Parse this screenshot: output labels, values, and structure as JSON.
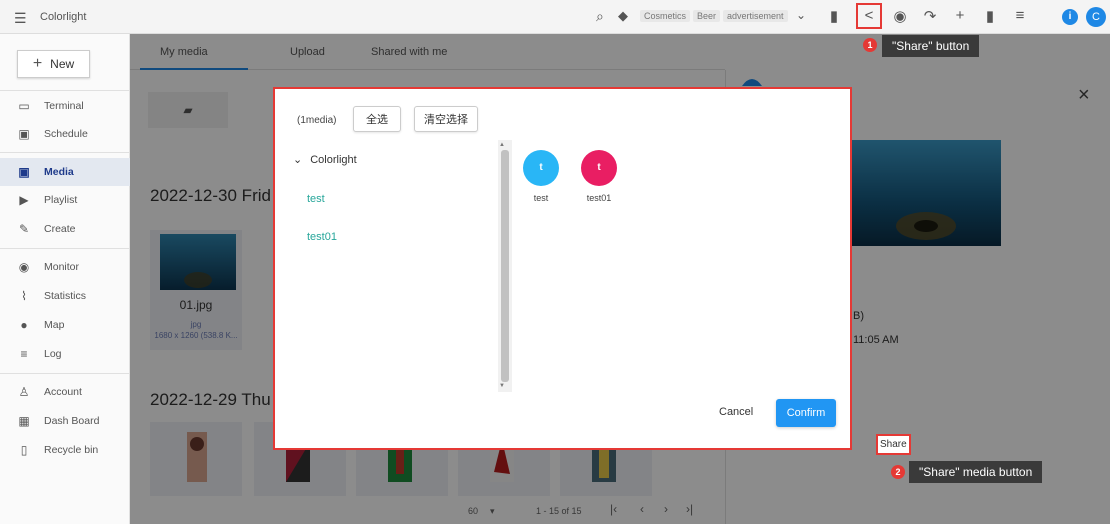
{
  "app": {
    "title": "Colorlight"
  },
  "topbar": {
    "tags": [
      "Cosmetics",
      "Beer",
      "advertisement"
    ],
    "icons": [
      "menu-icon",
      "search-icon",
      "tag-icon",
      "chevron-down-icon",
      "bookmark-icon",
      "share-icon",
      "eye-icon",
      "redo-icon",
      "plus-icon",
      "trash-icon",
      "list-icon",
      "info-icon"
    ],
    "info_letter": "i",
    "avatar_letter": "C"
  },
  "annotations": {
    "top_badge": "1",
    "top_label": "\"Share\" button",
    "bottom_badge": "2",
    "bottom_label": "\"Share\" media button",
    "share_text": "Share"
  },
  "sidebar": {
    "new_label": "New",
    "items": [
      {
        "label": "Terminal",
        "icon": "terminal-icon"
      },
      {
        "label": "Schedule",
        "icon": "calendar-icon"
      },
      {
        "label": "Media",
        "icon": "media-icon"
      },
      {
        "label": "Playlist",
        "icon": "playlist-icon"
      },
      {
        "label": "Create",
        "icon": "pencil-icon"
      },
      {
        "label": "Monitor",
        "icon": "eye-icon"
      },
      {
        "label": "Statistics",
        "icon": "chart-icon"
      },
      {
        "label": "Map",
        "icon": "map-pin-icon"
      },
      {
        "label": "Log",
        "icon": "list-icon"
      },
      {
        "label": "Account",
        "icon": "user-icon"
      },
      {
        "label": "Dash Board",
        "icon": "dashboard-icon"
      },
      {
        "label": "Recycle bin",
        "icon": "trash-icon"
      }
    ]
  },
  "tabs": [
    "My media",
    "Upload",
    "Shared with me"
  ],
  "media": {
    "groups": [
      {
        "date": "2022-12-30 Frid"
      },
      {
        "date": "2022-12-29 Thu"
      }
    ],
    "file": {
      "name": "01.jpg",
      "type": "jpg",
      "size": "1680 x 1260 (538.8 K..."
    }
  },
  "detail": {
    "partial_size": "B)",
    "partial_time": "11:05 AM",
    "close_icon": "close-icon"
  },
  "pager": {
    "per_page": "60",
    "range": "1 - 15 of 15"
  },
  "dialog": {
    "count": "(1media)",
    "select_all": "全选",
    "clear_selection": "清空选择",
    "tree_root": "Colorlight",
    "tree_items": [
      "test",
      "test01"
    ],
    "users": [
      {
        "initial": "t",
        "name": "test",
        "color": "#29b6f6"
      },
      {
        "initial": "t",
        "name": "test01",
        "color": "#e91e63"
      }
    ],
    "cancel": "Cancel",
    "confirm": "Confirm"
  }
}
